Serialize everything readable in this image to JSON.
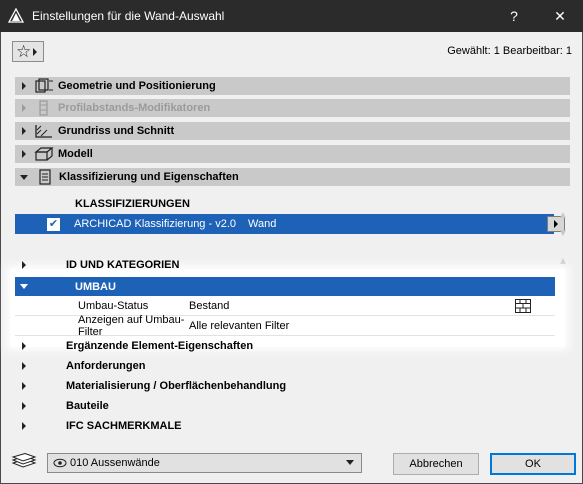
{
  "window": {
    "title": "Einstellungen für die Wand-Auswahl",
    "help_label": "?",
    "close_label": "✕"
  },
  "toolbar": {
    "favorites_icon": "star-icon",
    "selected_info": "Gewählt: 1 Bearbeitbar: 1"
  },
  "sections": [
    {
      "label": "Geometrie und Positionierung",
      "icon": "geometry-icon",
      "enabled": true,
      "expanded": false
    },
    {
      "label": "Profilabstands-Modifikatoren",
      "icon": "profile-offset-icon",
      "enabled": false,
      "expanded": false
    },
    {
      "label": "Grundriss und Schnitt",
      "icon": "floorplan-section-icon",
      "enabled": true,
      "expanded": false
    },
    {
      "label": "Modell",
      "icon": "model-icon",
      "enabled": true,
      "expanded": false
    },
    {
      "label": "Klassifizierung und Eigenschaften",
      "icon": "classification-icon",
      "enabled": true,
      "expanded": true
    }
  ],
  "classifications": {
    "heading": "KLASSIFIZIERUNGEN",
    "rows": [
      {
        "checked": true,
        "system": "ARCHICAD Klassifizierung - v2.0",
        "value": "Wand"
      }
    ]
  },
  "property_groups": [
    {
      "label": "ID UND KATEGORIEN",
      "expanded": false
    },
    {
      "label": "UMBAU",
      "expanded": true,
      "selected": true,
      "properties": [
        {
          "name": "Umbau-Status",
          "value": "Bestand"
        },
        {
          "name": "Anzeigen auf Umbau-Filter",
          "value": "Alle relevanten Filter"
        }
      ]
    },
    {
      "label": "Ergänzende Element-Eigenschaften",
      "expanded": false
    },
    {
      "label": "Anforderungen",
      "expanded": false
    },
    {
      "label": "Materialisierung / Oberflächenbehandlung",
      "expanded": false
    },
    {
      "label": "Bauteile",
      "expanded": false
    },
    {
      "label": "IFC SACHMERKMALE",
      "expanded": false
    }
  ],
  "footer": {
    "layer_value": "010 Aussenwände",
    "cancel_label": "Abbrechen",
    "ok_label": "OK"
  },
  "colors": {
    "selection": "#1e62b8",
    "section_bar": "#c9c9c9",
    "title_bar": "#2b2b2b"
  }
}
